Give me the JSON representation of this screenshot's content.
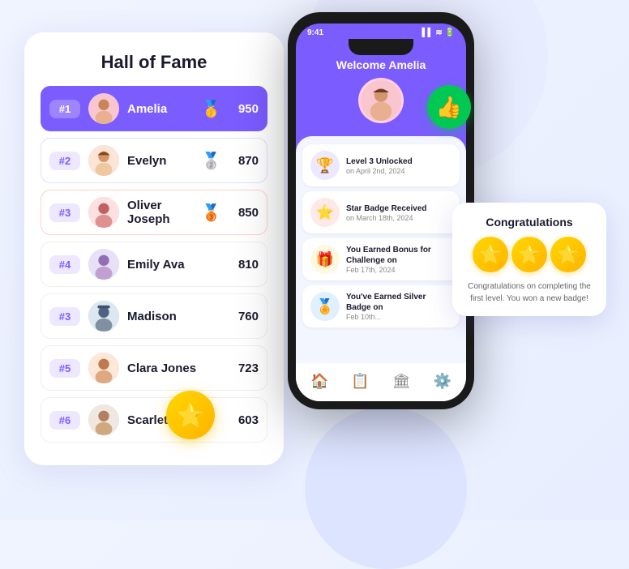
{
  "decorations": {
    "triangle_title": "triangle decoration",
    "thumbs_icon": "👍",
    "star_icon": "⭐"
  },
  "hall_of_fame": {
    "title": "Hall of Fame",
    "rows": [
      {
        "rank": "#1",
        "name": "Amelia",
        "score": "950",
        "medal": "🥇",
        "style": "rank1",
        "avatar": "👩"
      },
      {
        "rank": "#2",
        "name": "Evelyn",
        "score": "870",
        "medal": "🥈",
        "style": "rank2",
        "avatar": "👩"
      },
      {
        "rank": "#3",
        "name": "Oliver Joseph",
        "score": "850",
        "medal": "🥉",
        "style": "rank3",
        "avatar": "👦"
      },
      {
        "rank": "#4",
        "name": "Emily Ava",
        "score": "810",
        "medal": "",
        "style": "rank-other",
        "avatar": "👩"
      },
      {
        "rank": "#3",
        "name": "Madison",
        "score": "760",
        "medal": "",
        "style": "rank-other",
        "avatar": "👩"
      },
      {
        "rank": "#5",
        "name": "Clara Jones",
        "score": "723",
        "medal": "",
        "style": "rank-other",
        "avatar": "👩"
      },
      {
        "rank": "#6",
        "name": "Scarlett",
        "score": "603",
        "medal": "",
        "style": "rank-other",
        "avatar": "👩"
      }
    ]
  },
  "phone": {
    "status": {
      "time": "9:41",
      "signal": "▌▌▌",
      "wifi": "WiFi",
      "battery": "🔋"
    },
    "welcome": "Welcome Amelia",
    "avatar_emoji": "👩",
    "activities": [
      {
        "icon": "🏆",
        "icon_style": "purple",
        "title": "Level 3 Unlocked",
        "subtitle": "on April 2nd, 2024"
      },
      {
        "icon": "⭐",
        "icon_style": "red",
        "title": "Star Badge Received",
        "subtitle": "on March 18th, 2024"
      },
      {
        "icon": "🎁",
        "icon_style": "yellow",
        "title": "You Earned Bonus for Challenge on",
        "subtitle": "Feb 17th, 2024"
      },
      {
        "icon": "🏅",
        "icon_style": "blue",
        "title": "You've Earned Silver Badge on",
        "subtitle": "Feb 10th..."
      }
    ],
    "nav": [
      {
        "icon": "🏠",
        "label": "home",
        "active": true
      },
      {
        "icon": "📋",
        "label": "list",
        "active": false
      },
      {
        "icon": "🏛",
        "label": "leaderboard",
        "active": false
      },
      {
        "icon": "⚙",
        "label": "settings",
        "active": false
      }
    ]
  },
  "congrats": {
    "title": "Congratulations",
    "stars": [
      "⭐",
      "⭐",
      "⭐"
    ],
    "text": "Congratulations on completing the first level. You won a new badge!"
  }
}
